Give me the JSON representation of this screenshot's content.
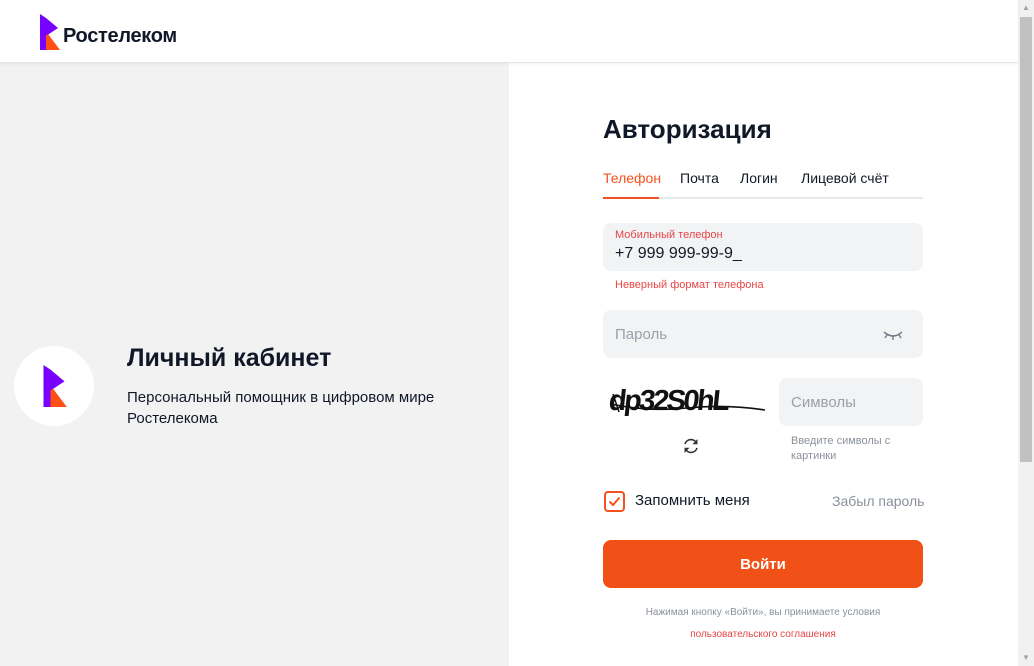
{
  "header": {
    "brand": "Ростелеком"
  },
  "promo": {
    "title": "Личный кабинет",
    "subtitle": "Персональный помощник в цифровом мире Ростелекома"
  },
  "auth": {
    "title": "Авторизация",
    "tabs": [
      {
        "label": "Телефон",
        "active": true
      },
      {
        "label": "Почта",
        "active": false
      },
      {
        "label": "Логин",
        "active": false
      },
      {
        "label": "Лицевой счёт",
        "active": false
      }
    ],
    "phone": {
      "label": "Мобильный телефон",
      "value": "+7 999 999-99-9_",
      "error": "Неверный формат телефона"
    },
    "password": {
      "placeholder": "Пароль",
      "icon": "eye-closed-icon"
    },
    "captcha": {
      "text": "dp32S0hL",
      "placeholder": "Символы",
      "hint": "Введите символы с картинки",
      "refresh_icon": "refresh-icon"
    },
    "remember": {
      "label": "Запомнить меня",
      "checked": true
    },
    "forgot": "Забыл пароль",
    "submit": "Войти",
    "terms_text": "Нажимая кнопку «Войти», вы принимаете условия",
    "terms_link": "пользовательского соглашения"
  },
  "colors": {
    "accent": "#f15116",
    "brand_purple": "#7700ff",
    "error": "#e64646",
    "panel_bg": "#f2f2f2",
    "field_bg": "#f2f3f5"
  }
}
